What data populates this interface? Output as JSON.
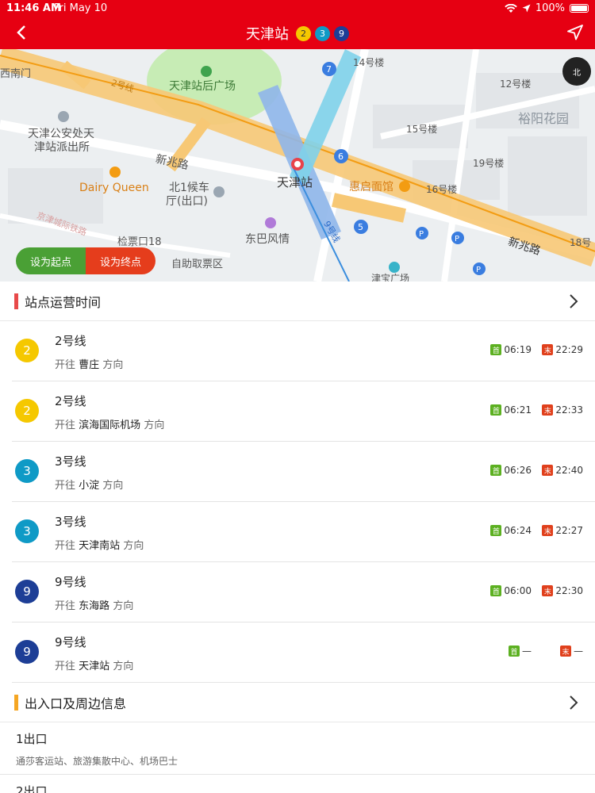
{
  "status_bar": {
    "time": "11:46 AM",
    "date": "Fri May 10",
    "battery": "100%"
  },
  "header": {
    "title": "天津站",
    "lines": [
      {
        "label": "2",
        "color": "#f5c800"
      },
      {
        "label": "3",
        "color": "#0f9ac6"
      },
      {
        "label": "9",
        "color": "#1d3e96"
      }
    ]
  },
  "map": {
    "labels": {
      "west_gate": "西南门",
      "plaza": "天津站后广场",
      "line2": "2号线",
      "police": "天津公安处天津站派出所",
      "police_line2": "津站派出所",
      "police_line1": "天津公安处天",
      "xinzhao": "新兆路",
      "dairy_queen": "Dairy Queen",
      "bei1": "北1候车",
      "bei1_exit": "厅(出口)",
      "station": "天津站",
      "huiqi": "惠启面馆",
      "dongba": "东巴风情",
      "jianpiao": "检票口18",
      "zizhu": "自助取票区",
      "b14": "14号楼",
      "b12": "12号楼",
      "b15": "15号楼",
      "b19": "19号楼",
      "b16": "16号楼",
      "b18": "18号",
      "yuyang": "裕阳花园",
      "xinzhao2": "新兆路",
      "jinwan": "津宝广场",
      "line9": "9号线",
      "rail": "京津城际铁路"
    },
    "compass": "北",
    "start_btn": "设为起点",
    "end_btn": "设为终点"
  },
  "section_ops": {
    "title": "站点运营时间",
    "bar_color": "#e84a4a"
  },
  "first_tag": "首",
  "last_tag": "末",
  "toward": "开往",
  "direction": "方向",
  "lines": [
    {
      "number": "2",
      "name": "2号线",
      "dest": "曹庄",
      "first": "06:19",
      "last": "22:29",
      "color": "#f5c800"
    },
    {
      "number": "2",
      "name": "2号线",
      "dest": "滨海国际机场",
      "first": "06:21",
      "last": "22:33",
      "color": "#f5c800"
    },
    {
      "number": "3",
      "name": "3号线",
      "dest": "小淀",
      "first": "06:26",
      "last": "22:40",
      "color": "#0f9ac6"
    },
    {
      "number": "3",
      "name": "3号线",
      "dest": "天津南站",
      "first": "06:24",
      "last": "22:27",
      "color": "#0f9ac6"
    },
    {
      "number": "9",
      "name": "9号线",
      "dest": "东海路",
      "first": "06:00",
      "last": "22:30",
      "color": "#1d3e96"
    },
    {
      "number": "9",
      "name": "9号线",
      "dest": "天津站",
      "first": "—",
      "last": "—",
      "color": "#1d3e96"
    }
  ],
  "section_exits": {
    "title": "出入口及周边信息",
    "bar_color": "#f5a623"
  },
  "exits": [
    {
      "name": "1出口",
      "desc": "通莎客运站、旅游集散中心、机场巴士"
    },
    {
      "name": "2出口",
      "desc": ""
    }
  ]
}
